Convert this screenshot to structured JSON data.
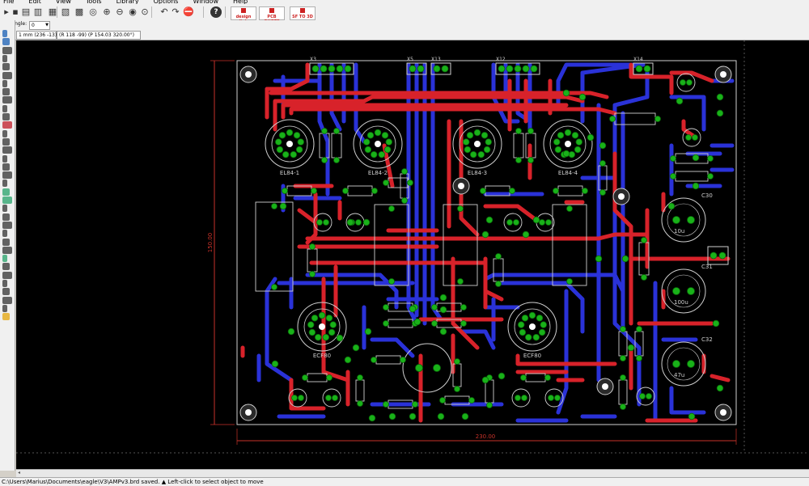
{
  "menu": {
    "items": [
      "File",
      "Edit",
      "View",
      "Tools",
      "Library",
      "Options",
      "Window",
      "Help"
    ]
  },
  "toolbar": {
    "buttons": [
      "open-icon",
      "save-icon",
      "print-icon",
      "cam-icon",
      "ulp-icon",
      "script-icon",
      "grid-icon",
      "zoom-fit-icon",
      "zoom-in-icon",
      "zoom-out-icon",
      "redraw-icon",
      "zoom-select-icon",
      "undo-icon",
      "redo-icon",
      "stop-icon",
      "help-icon"
    ],
    "badges": [
      {
        "label": "design link",
        "color": "#cc2222"
      },
      {
        "label": "PCB QUOTE",
        "color": "#cc2222"
      },
      {
        "label": "SF TO 3D",
        "color": "#cc2222"
      }
    ]
  },
  "params": {
    "angle_label": "Angle:",
    "angle_value": "0"
  },
  "coords": {
    "grid": "1 mm (236 -13)",
    "r": "(R 118 -99) (P 154.03 320.00°)"
  },
  "status": {
    "text": "C:\\Users\\Marius\\Documents\\eagle\\V3\\AMPv3.brd saved.  ▲ Left-click to select object to move"
  },
  "board": {
    "dim_vertical": "150.00",
    "dim_horizontal": "230.00",
    "connectors": [
      "X3",
      "X5",
      "X13",
      "X12",
      "X14"
    ],
    "tubes": [
      "EL84-1",
      "EL84-2",
      "EL84-3",
      "EL84-4",
      "ECF80",
      "ECF80"
    ],
    "caps": [
      "C30",
      "C31",
      "C32",
      "10u",
      "100u",
      "47u"
    ],
    "colors": {
      "top": "#d8222a",
      "bottom": "#2a32d8",
      "pad": "#19b219",
      "silk": "#cfcfcf"
    }
  }
}
